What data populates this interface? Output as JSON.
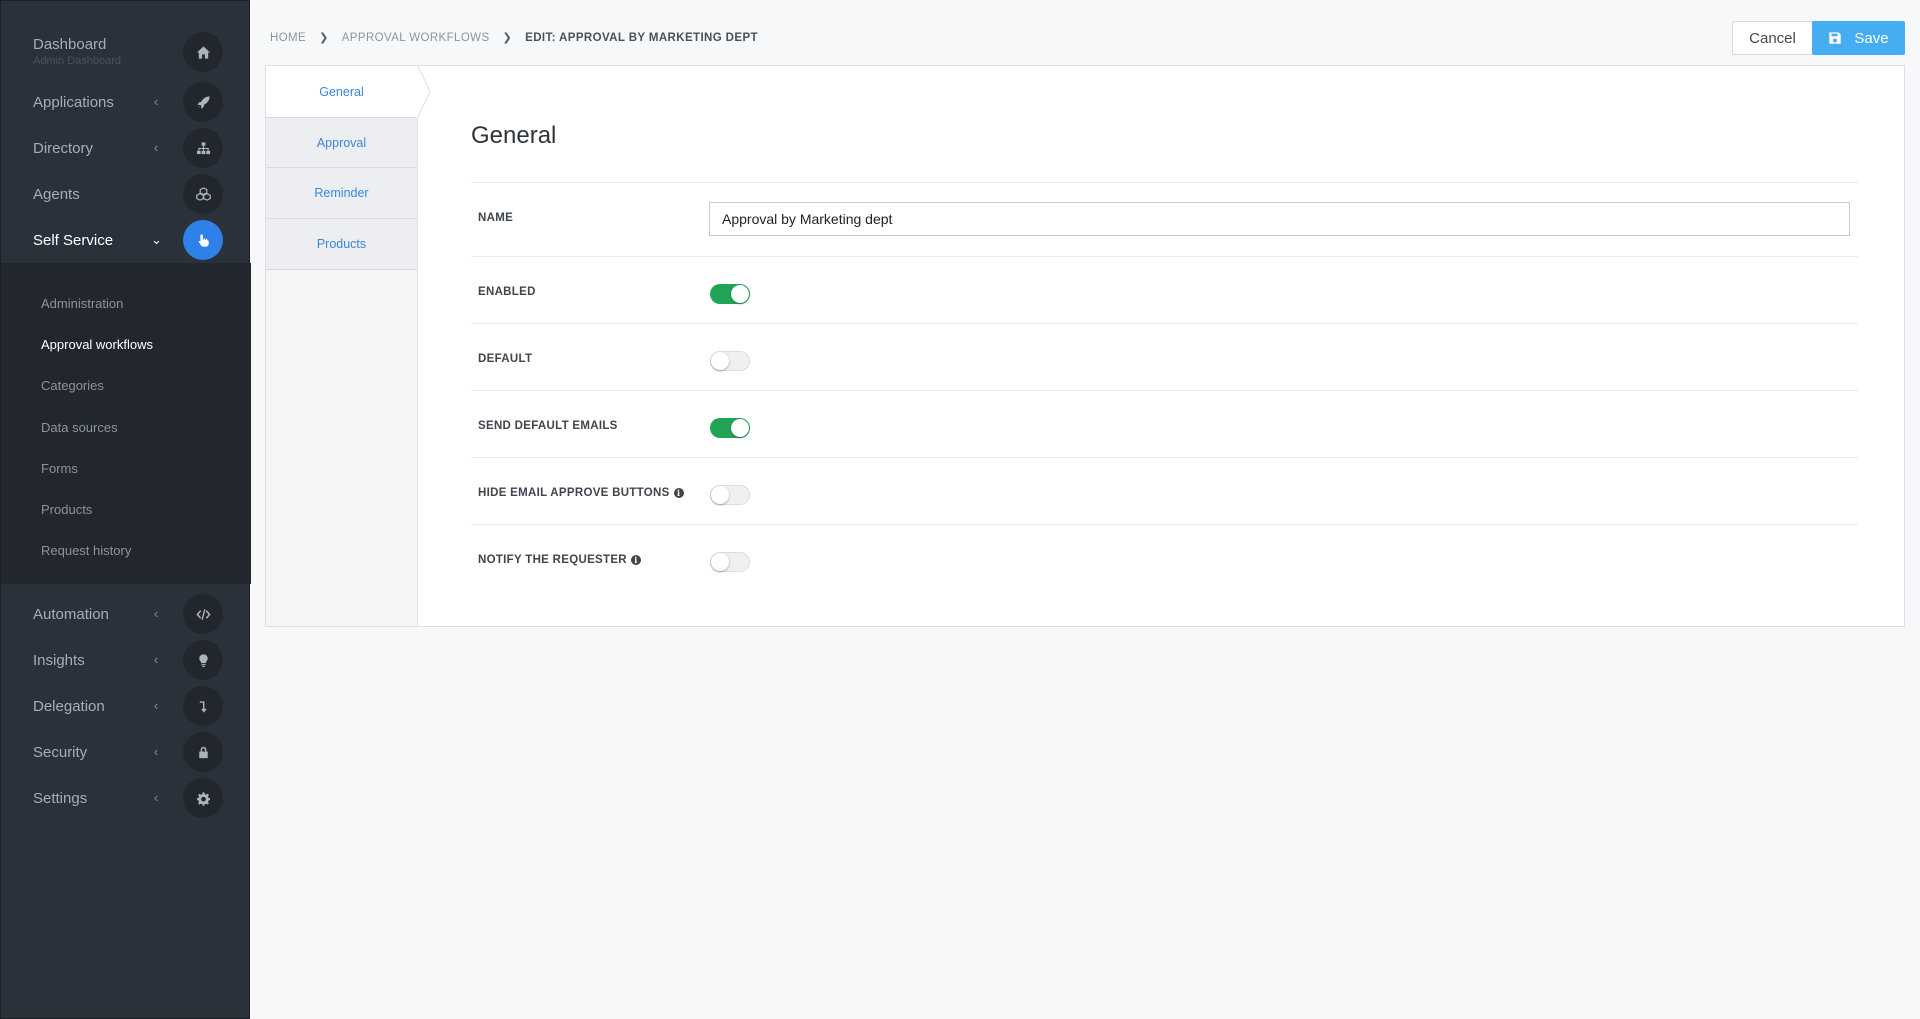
{
  "sidebar": {
    "items": [
      {
        "label": "Dashboard",
        "sub": "Admin Dashboard",
        "icon": "home-icon"
      },
      {
        "label": "Applications",
        "icon": "rocket-icon"
      },
      {
        "label": "Directory",
        "icon": "sitemap-icon"
      },
      {
        "label": "Agents",
        "icon": "cubes-icon"
      },
      {
        "label": "Self Service",
        "icon": "hand-pointer-icon"
      },
      {
        "label": "Automation",
        "icon": "code-icon"
      },
      {
        "label": "Insights",
        "icon": "lightbulb-icon"
      },
      {
        "label": "Delegation",
        "icon": "arrow-turn-down-icon"
      },
      {
        "label": "Security",
        "icon": "lock-icon"
      },
      {
        "label": "Settings",
        "icon": "gear-icon"
      }
    ],
    "submenu": [
      "Administration",
      "Approval workflows",
      "Categories",
      "Data sources",
      "Forms",
      "Products",
      "Request history"
    ]
  },
  "breadcrumb": {
    "home": "HOME",
    "parent": "APPROVAL WORKFLOWS",
    "current": "EDIT: APPROVAL BY MARKETING DEPT"
  },
  "actions": {
    "cancel": "Cancel",
    "save": "Save"
  },
  "tabs": [
    "General",
    "Approval",
    "Reminder",
    "Products"
  ],
  "form": {
    "title": "General",
    "name_label": "NAME",
    "name_value": "Approval by Marketing dept",
    "toggles": [
      {
        "label": "ENABLED",
        "value": true,
        "info": false
      },
      {
        "label": "DEFAULT",
        "value": false,
        "info": false
      },
      {
        "label": "SEND DEFAULT EMAILS",
        "value": true,
        "info": false
      },
      {
        "label": "HIDE EMAIL APPROVE BUTTONS",
        "value": false,
        "info": true
      },
      {
        "label": "NOTIFY THE REQUESTER",
        "value": false,
        "info": true
      }
    ]
  },
  "colors": {
    "accent": "#2f80e8",
    "save": "#45adf2",
    "toggle_on": "#21a456",
    "sidebar": "#2b313b"
  }
}
